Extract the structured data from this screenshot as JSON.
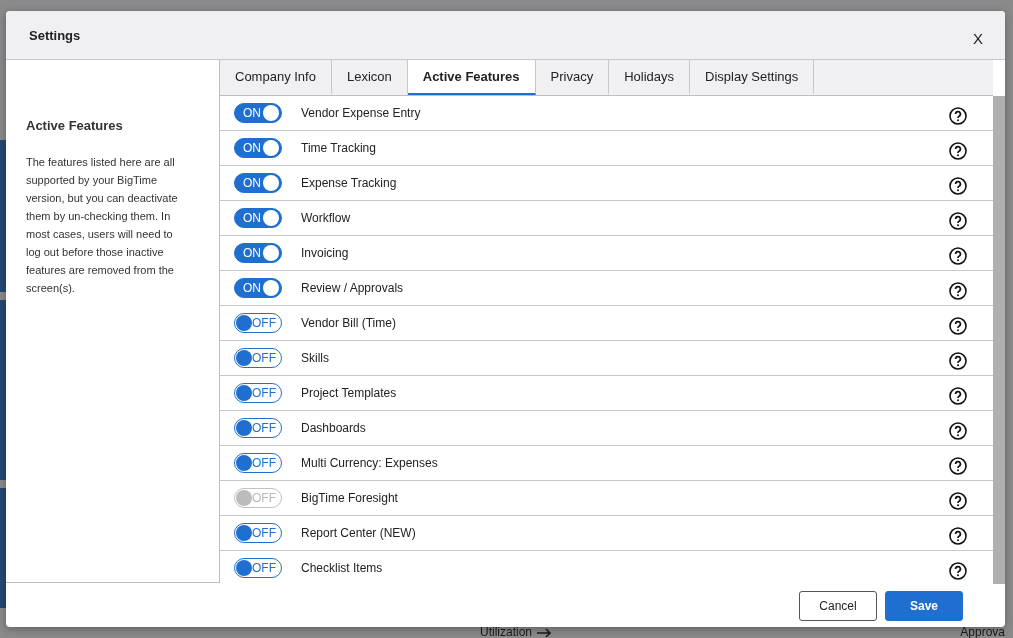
{
  "background": {
    "texts": [
      {
        "label": "Utilization",
        "arrow": true
      },
      {
        "label": "Approva",
        "arrow": false
      }
    ]
  },
  "dialog": {
    "title": "Settings",
    "close": "X"
  },
  "sidebar": {
    "heading": "Active Features",
    "description": "The features listed here are all supported by your BigTime version, but you can deactivate them by un-checking them. In most cases, users will need to log out before those inactive features are removed from the screen(s)."
  },
  "tabs": [
    {
      "label": "Company Info",
      "selected": false
    },
    {
      "label": "Lexicon",
      "selected": false
    },
    {
      "label": "Active Features",
      "selected": true
    },
    {
      "label": "Privacy",
      "selected": false
    },
    {
      "label": "Holidays",
      "selected": false
    },
    {
      "label": "Display Settings",
      "selected": false
    }
  ],
  "features": [
    {
      "name": "Vendor Expense Entry",
      "on": true,
      "disabled": false,
      "toggle": "ON"
    },
    {
      "name": "Time Tracking",
      "on": true,
      "disabled": false,
      "toggle": "ON"
    },
    {
      "name": "Expense Tracking",
      "on": true,
      "disabled": false,
      "toggle": "ON"
    },
    {
      "name": "Workflow",
      "on": true,
      "disabled": false,
      "toggle": "ON"
    },
    {
      "name": "Invoicing",
      "on": true,
      "disabled": false,
      "toggle": "ON"
    },
    {
      "name": "Review / Approvals",
      "on": true,
      "disabled": false,
      "toggle": "ON"
    },
    {
      "name": "Vendor Bill (Time)",
      "on": false,
      "disabled": false,
      "toggle": "OFF"
    },
    {
      "name": "Skills",
      "on": false,
      "disabled": false,
      "toggle": "OFF"
    },
    {
      "name": "Project Templates",
      "on": false,
      "disabled": false,
      "toggle": "OFF"
    },
    {
      "name": "Dashboards",
      "on": false,
      "disabled": false,
      "toggle": "OFF"
    },
    {
      "name": "Multi Currency: Expenses",
      "on": false,
      "disabled": false,
      "toggle": "OFF"
    },
    {
      "name": "BigTime Foresight",
      "on": false,
      "disabled": true,
      "toggle": "OFF"
    },
    {
      "name": "Report Center (NEW)",
      "on": false,
      "disabled": false,
      "toggle": "OFF"
    },
    {
      "name": "Checklist Items",
      "on": false,
      "disabled": false,
      "toggle": "OFF"
    }
  ],
  "buttons": [
    {
      "label": "Cancel",
      "kind": "secondary"
    },
    {
      "label": "Save",
      "kind": "primary"
    }
  ]
}
